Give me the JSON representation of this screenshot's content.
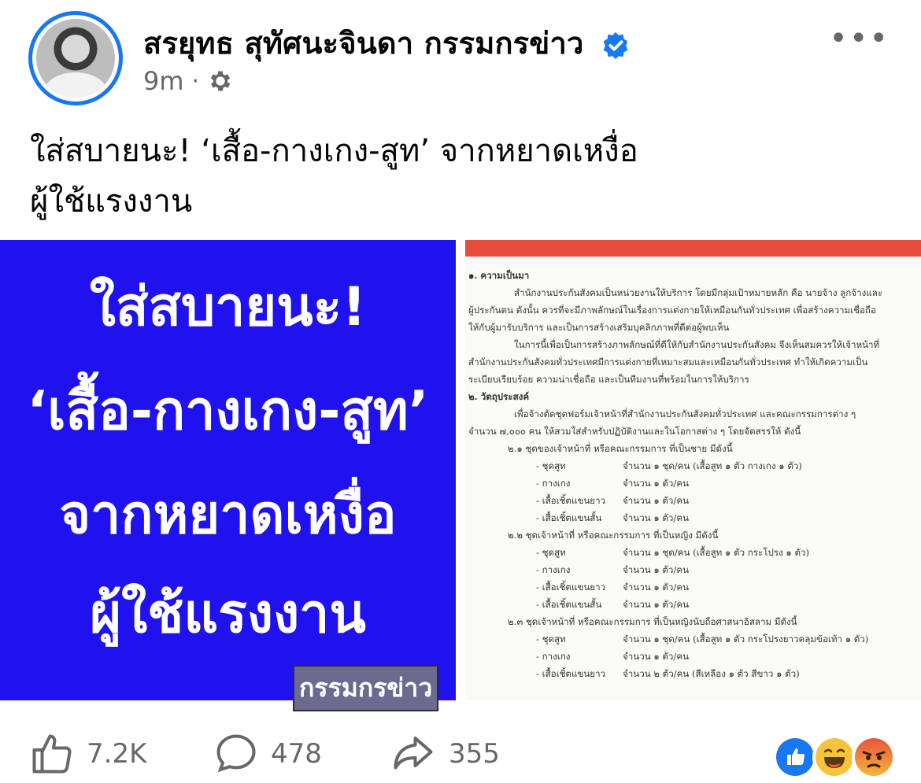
{
  "post": {
    "author": "สรยุทธ สุทัศนะจินดา กรรมกรข่าว",
    "time": "9m",
    "separator": "·",
    "privacy_icon": "gear-icon",
    "caption_line1": "ใส่สบายนะ! ‘เสื้อ-กางเกง-สูท’ จากหยาดเหงื่อ",
    "caption_line2": "ผู้ใช้แรงงาน",
    "more_label": "•••"
  },
  "image_left": {
    "line1": "ใส่สบายนะ!",
    "line2": "‘เสื้อ-กางเกง-สูท’",
    "line3": "จากหยาดเหงื่อ",
    "line4": "ผู้ใช้แรงงาน",
    "stamp": "กรรมกรข่าว",
    "bg_color": "#1f12ee"
  },
  "image_right": {
    "s1_title": "๑. ความเป็นมา",
    "s1_p1a": "สำนักงานประกันสังคมเป็นหน่วยงานให้บริการ โดยมีกลุ่มเป้าหมายหลัก คือ นายจ้าง ลูกจ้างและ",
    "s1_p1b": "ผู้ประกันตน ดังนั้น ควรที่จะมีภาพลักษณ์ในเรื่องการแต่งกายให้เหมือนกันทั่วประเทศ เพื่อสร้างความเชื่อถือ",
    "s1_p1c": "ให้กับผู้มารับบริการ และเป็นการสร้างเสริมบุคลิกภาพที่ดีต่อผู้พบเห็น",
    "s1_p2a": "ในการนี้เพื่อเป็นการสร้างภาพลักษณ์ที่ดีให้กับสำนักงานประกันสังคม จึงเห็นสมควรให้เจ้าหน้าที่",
    "s1_p2b": "สำนักงานประกันสังคมทั่วประเทศมีการแต่งกายที่เหมาะสมและเหมือนกันทั่วประเทศ ทำให้เกิดความเป็น",
    "s1_p2c": "ระเบียบเรียบร้อย ความน่าเชื่อถือ และเป็นทีมงานที่พร้อมในการให้บริการ",
    "s2_title": "๒. วัตถุประสงค์",
    "s2_p1a": "เพื่อจ้างตัดชุดฟอร์มเจ้าหน้าที่สำนักงานประกันสังคมทั่วประเทศ และคณะกรรมการต่าง ๆ",
    "s2_p1b": "จำนวน ๗,๐๐๐ คน ให้สวมใส่สำหรับปฏิบัติงานและในโอกาสต่าง ๆ โดยจัดสรรให้ ดังนี้",
    "g1_title": "๒.๑ ชุดของเจ้าหน้าที่ หรือคณะกรรมการ ที่เป็นชาย มีดังนี้",
    "g1_items": [
      {
        "k": "- ชุดสูท",
        "v": "จำนวน ๑ ชุด/คน (เสื้อสูท ๑ ตัว กางเกง ๑ ตัว)"
      },
      {
        "k": "- กางเกง",
        "v": "จำนวน ๑ ตัว/คน"
      },
      {
        "k": "- เสื้อเชิ้ตแขนยาว",
        "v": "จำนวน ๑ ตัว/คน"
      },
      {
        "k": "- เสื้อเชิ้ตแขนสั้น",
        "v": "จำนวน ๑ ตัว/คน"
      }
    ],
    "g2_title": "๒.๒ ชุดเจ้าหน้าที่ หรือคณะกรรมการ ที่เป็นหญิง มีดังนี้",
    "g2_items": [
      {
        "k": "- ชุดสูท",
        "v": "จำนวน ๑ ชุด/คน (เสื้อสูท ๑ ตัว กระโปรง ๑ ตัว)"
      },
      {
        "k": "- กางเกง",
        "v": "จำนวน ๑ ตัว/คน"
      },
      {
        "k": "- เสื้อเชิ้ตแขนยาว",
        "v": "จำนวน ๑ ตัว/คน"
      },
      {
        "k": "- เสื้อเชิ้ตแขนสั้น",
        "v": "จำนวน ๑ ตัว/คน"
      }
    ],
    "g3_title": "๒.๓ ชุดเจ้าหน้าที่ หรือคณะกรรมการ ที่เป็นหญิงนับถือศาสนาอิสลาม มีดังนี้",
    "g3_items": [
      {
        "k": "- ชุดสูท",
        "v": "จำนวน ๑ ชุด/คน (เสื้อสูท ๑ ตัว กระโปรงยาวคลุมข้อเท้า ๑ ตัว)"
      },
      {
        "k": "- กางเกง",
        "v": "จำนวน ๑ ตัว/คน"
      },
      {
        "k": "- เสื้อเชิ้ตแขนยาว",
        "v": "จำนวน ๒ ตัว/คน (สีเหลือง ๑ ตัว สีขาว ๑ ตัว)"
      }
    ]
  },
  "actions": {
    "likes": "7.2K",
    "comments": "478",
    "shares": "355",
    "like_icon": "thumbs-up-icon",
    "comment_icon": "comment-bubble-icon",
    "share_icon": "share-arrow-icon"
  },
  "reactions": [
    "like-reaction-icon",
    "haha-reaction-icon",
    "angry-reaction-icon"
  ],
  "colors": {
    "accent": "#1877f2",
    "muted": "#65676b",
    "doc_bar": "#e74c3c"
  }
}
